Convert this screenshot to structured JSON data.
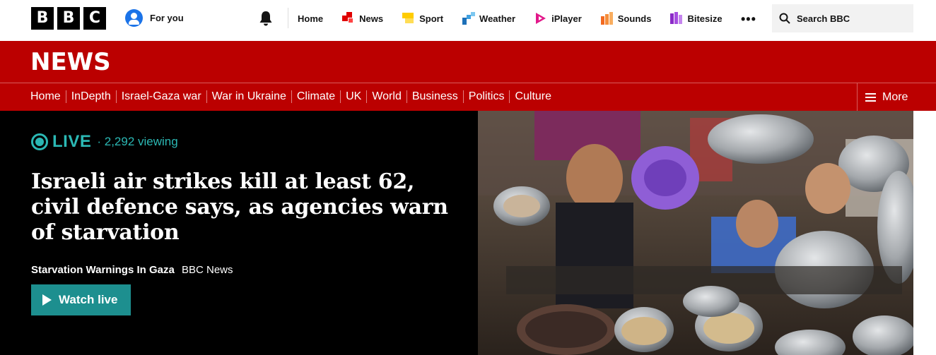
{
  "logo": {
    "letters": [
      "B",
      "B",
      "C"
    ]
  },
  "account": {
    "label": "For you",
    "icon": "user-avatar-icon"
  },
  "notifications": {
    "icon": "bell-icon"
  },
  "topnav": [
    {
      "label": "Home",
      "icon": null,
      "color": null
    },
    {
      "label": "News",
      "icon": "news-icon",
      "color": "#e00000"
    },
    {
      "label": "Sport",
      "icon": "sport-icon",
      "color": "#ffcc00"
    },
    {
      "label": "Weather",
      "icon": "weather-icon",
      "color": "#1d70b8"
    },
    {
      "label": "iPlayer",
      "icon": "iplayer-icon",
      "color": "#e2188a"
    },
    {
      "label": "Sounds",
      "icon": "sounds-icon",
      "color": "#f26a21"
    },
    {
      "label": "Bitesize",
      "icon": "bitesize-icon",
      "color": "#8b2ac8"
    }
  ],
  "more_icon": "more-dots-icon",
  "search": {
    "placeholder": "Search BBC"
  },
  "section": {
    "title": "NEWS",
    "brand_color": "#bb0000"
  },
  "subnav": [
    "Home",
    "InDepth",
    "Israel-Gaza war",
    "War in Ukraine",
    "Climate",
    "UK",
    "World",
    "Business",
    "Politics",
    "Culture"
  ],
  "more_menu": {
    "label": "More"
  },
  "hero": {
    "live_label": "LIVE",
    "viewing": "2,292 viewing",
    "headline": "Israeli air strikes kill at least 62, civil defence says, as agencies warn of starvation",
    "topic": "Starvation Warnings In Gaza",
    "source": "BBC News",
    "watch_label": "Watch live",
    "accent": "#2bb8b4",
    "image_alt": "photo of crowd reaching pots toward food"
  }
}
